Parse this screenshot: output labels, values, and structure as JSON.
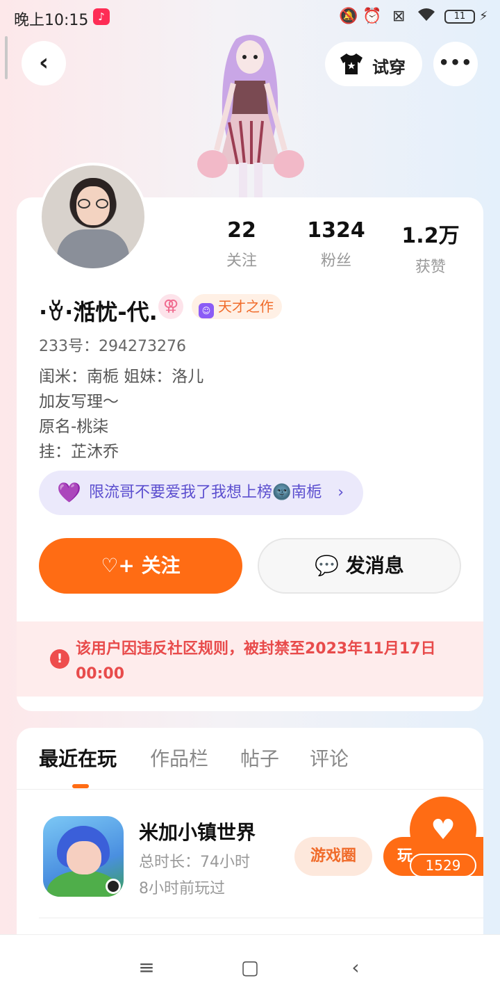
{
  "status_bar": {
    "time": "晚上10:15",
    "battery": "11"
  },
  "header": {
    "try_on_label": "试穿"
  },
  "stats": [
    {
      "value": "22",
      "label": "关注"
    },
    {
      "value": "1324",
      "label": "粉丝"
    },
    {
      "value": "1.2万",
      "label": "获赞"
    }
  ],
  "profile": {
    "username": "·ꈊ·湉忧-代.",
    "gender_symbol": "⚢",
    "badge": "天才之作",
    "id_line": "233号：294273276",
    "bio": [
      "闺米：南栀 姐妹：洛儿",
      "加友写理～",
      "原名-桃柒",
      "挂：芷沐乔"
    ],
    "hot_tag": "限流哥不要爱我了我想上榜🌚南栀"
  },
  "actions": {
    "follow": "关注",
    "message": "发消息"
  },
  "ban_notice": "该用户因违反社区规则，被封禁至2023年11月17日 00:00",
  "tabs": [
    {
      "label": "最近在玩",
      "active": true
    },
    {
      "label": "作品栏",
      "active": false
    },
    {
      "label": "帖子",
      "active": false
    },
    {
      "label": "评论",
      "active": false
    }
  ],
  "game": {
    "name": "米加小镇世界",
    "duration": "总时长：74小时",
    "last_played": "8小时前玩过",
    "circle_label": "游戏圈",
    "play_label": "玩"
  },
  "like_fab": {
    "count": "1529"
  },
  "colors": {
    "accent": "#ff6c14",
    "ban_text": "#e84b4b",
    "hot_tag": "#5b4ecf"
  }
}
